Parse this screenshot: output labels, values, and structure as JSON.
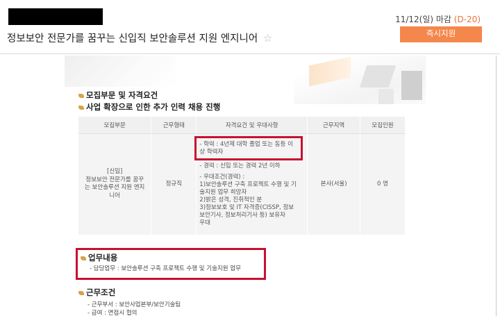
{
  "header": {
    "job_title": "정보보안 전문가를 꿈꾸는 신입직 보안솔루션 지원 엔지니어",
    "deadline_date": "11/12(일) 마감",
    "d_day": "(D-20)",
    "apply_label": "즉시지원",
    "colors": {
      "accent": "#f4874b",
      "dday": "#e8743b"
    }
  },
  "recruit": {
    "section_title": "모집부문 및 자격요건",
    "subtitle": "사업 확장으로 인한 추가 인력 채용 진행",
    "columns": [
      "모집부문",
      "근무형태",
      "자격요건 및 우대사항",
      "근무지역",
      "모집인원"
    ],
    "row": {
      "part": "[신입]\n정보보안 전문가를 꿈꾸\n는 보안솔루션 지원 엔지\n니어",
      "type": "정규직",
      "req_edu": "- 학력 : 4년제 대학 졸업 또는 동등 이\n상 학력자",
      "req_career": "- 경력 : 신입 또는 경력 2년 이하",
      "req_pref": "- 우대조건(경력) :\n1)보안솔루션 구축 프로젝트 수행 및 기\n술지원 업무 희망자\n2)밝은 성격, 진취적인 분\n3)정보보호 및 IT 자격증(CISSP, 정보\n보안기사, 정보처리기사  등) 보유자\n우대",
      "location": "본사(서울)",
      "count": "0 명"
    }
  },
  "duty": {
    "section_title": "업무내용",
    "line": "- 담당업무 : 보안솔루션 구축 프로젝트 수행 및 기술지원 업무"
  },
  "conditions": {
    "section_title": "근무조건",
    "line1": "- 근무부서 : 보안사업본부/보안기술팀",
    "line2": "- 급여 : 면접시 협의"
  }
}
